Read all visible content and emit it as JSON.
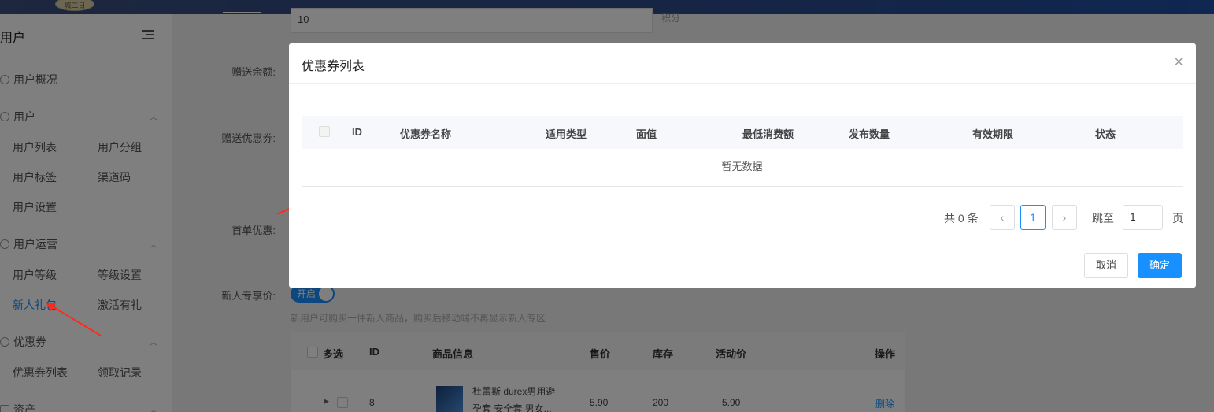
{
  "topbar": {
    "logo_text": "城二日"
  },
  "sidebar": {
    "title": "用户",
    "overview": "用户概况",
    "group_user": "用户",
    "user_list": "用户列表",
    "user_group": "用户分组",
    "user_tag": "用户标签",
    "channel_code": "渠道码",
    "user_settings": "用户设置",
    "group_ops": "用户运营",
    "user_level": "用户等级",
    "level_settings": "等级设置",
    "newbie_gift": "新人礼包",
    "activation_gift": "激活有礼",
    "group_coupon": "优惠券",
    "coupon_list": "优惠券列表",
    "claim_records": "领取记录",
    "group_assets": "资产"
  },
  "form": {
    "input_value": "10",
    "unit": "积分",
    "gift_balance": "赠送余额:",
    "gift_coupon": "赠送优惠券:",
    "first_order": "首单优惠:",
    "newbie_price": "新人专享价:",
    "toggle_label": "开启",
    "hint": "新用户可购买一件新人商品，购买后移动端不再显示新人专区"
  },
  "product_table": {
    "headers": [
      "多选",
      "ID",
      "商品信息",
      "售价",
      "库存",
      "活动价",
      "操作"
    ],
    "row": {
      "id": "8",
      "info_line1": "杜蕾斯 durex男用避",
      "info_line2": "孕套 安全套 男女...",
      "price": "5.90",
      "stock": "200",
      "activity_price": "5.90",
      "action": "删除"
    }
  },
  "modal": {
    "title": "优惠券列表",
    "close": "×",
    "headers": [
      "ID",
      "优惠券名称",
      "适用类型",
      "面值",
      "最低消费额",
      "发布数量",
      "有效期限",
      "状态"
    ],
    "empty_text": "暂无数据",
    "total": "共 0 条",
    "prev": "‹",
    "current_page": "1",
    "next": "›",
    "jump_to": "跳至",
    "jump_value": "1",
    "page_unit": "页",
    "cancel": "取消",
    "confirm": "确定"
  },
  "colors": {
    "accent": "#1890ff",
    "annotation_arrow": "#ff2a1a"
  }
}
